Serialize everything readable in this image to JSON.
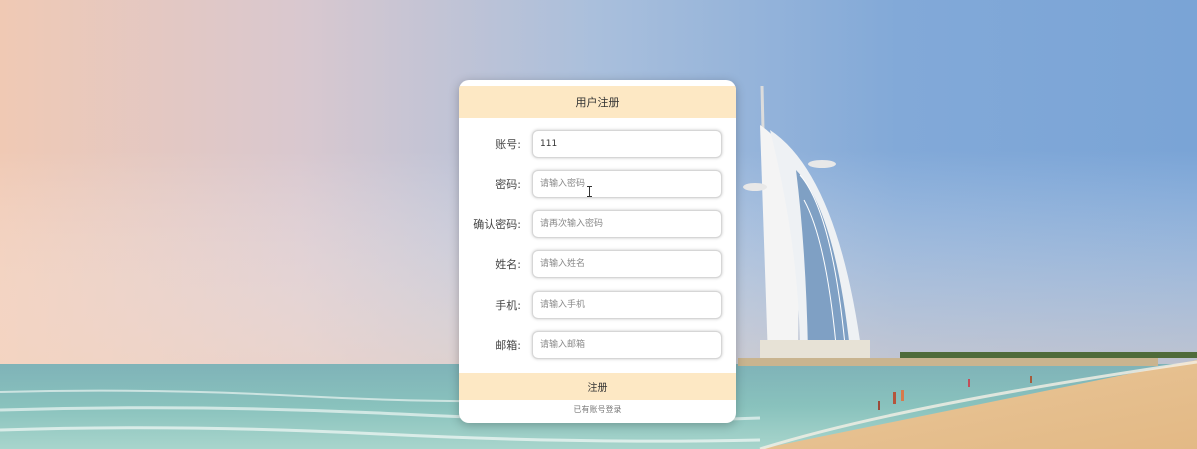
{
  "form": {
    "title": "用户注册",
    "fields": [
      {
        "label": "账号:",
        "value": "111",
        "placeholder": ""
      },
      {
        "label": "密码:",
        "value": "",
        "placeholder": "请输入密码"
      },
      {
        "label": "确认密码:",
        "value": "",
        "placeholder": "请再次输入密码"
      },
      {
        "label": "姓名:",
        "value": "",
        "placeholder": "请输入姓名"
      },
      {
        "label": "手机:",
        "value": "",
        "placeholder": "请输入手机"
      },
      {
        "label": "邮箱:",
        "value": "",
        "placeholder": "请输入邮箱"
      }
    ],
    "submit_label": "注册",
    "login_link": "已有账号登录"
  },
  "colors": {
    "header_bg": "#fde8c4",
    "card_bg": "#ffffff"
  }
}
